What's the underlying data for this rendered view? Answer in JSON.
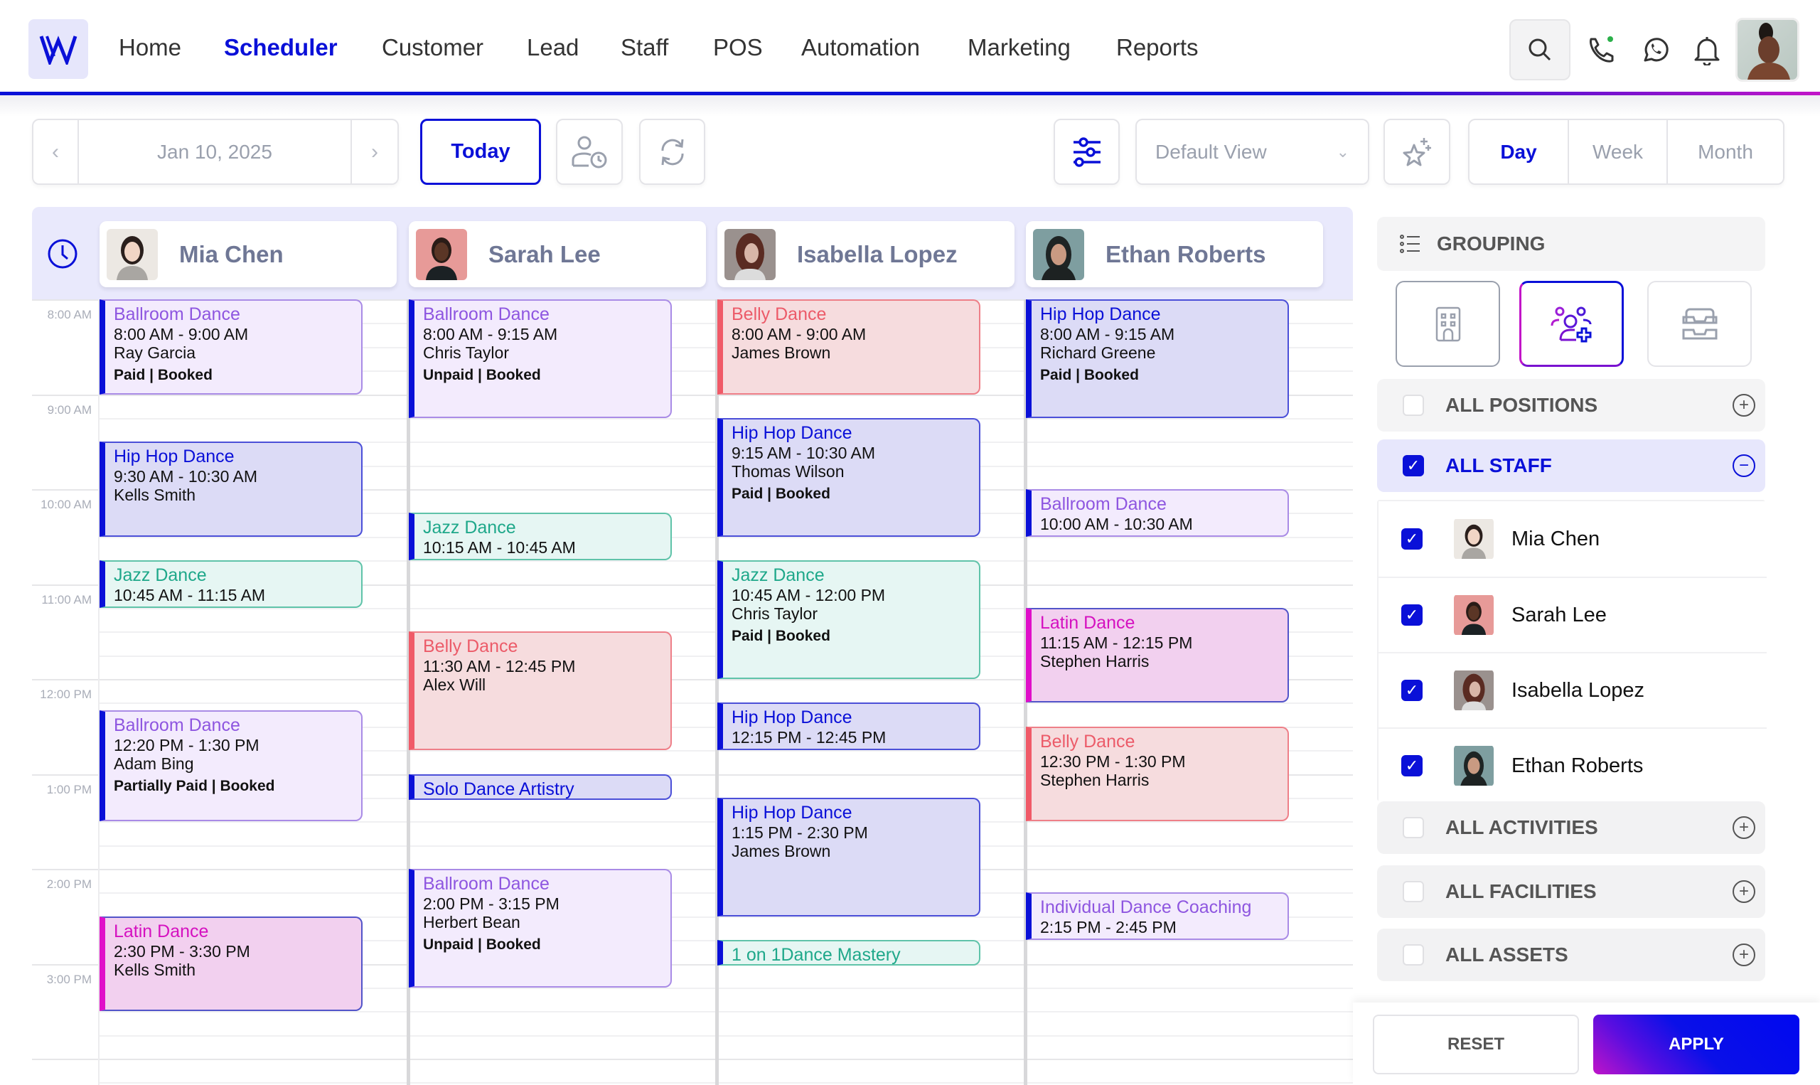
{
  "header": {
    "logo_letter": "W",
    "nav": [
      {
        "label": "Home",
        "active": false
      },
      {
        "label": "Scheduler",
        "active": true
      },
      {
        "label": "Customer",
        "active": false
      },
      {
        "label": "Lead",
        "active": false
      },
      {
        "label": "Staff",
        "active": false
      },
      {
        "label": "POS",
        "active": false
      },
      {
        "label": "Automation",
        "active": false
      },
      {
        "label": "Marketing",
        "active": false
      },
      {
        "label": "Reports",
        "active": false
      }
    ],
    "icons": [
      "search-icon",
      "phone-icon",
      "whatsapp-icon",
      "bell-icon"
    ],
    "phone_status_color": "#2bb04a"
  },
  "toolbar": {
    "date": "Jan 10, 2025",
    "today_label": "Today",
    "view_select": "Default View",
    "view_modes": [
      {
        "label": "Day",
        "active": true
      },
      {
        "label": "Week",
        "active": false
      },
      {
        "label": "Month",
        "active": false
      }
    ]
  },
  "colors": {
    "accent": "#0a10d8",
    "magenta": "#d511c0"
  },
  "calendar": {
    "staff": [
      {
        "name": "Mia Chen",
        "photo_bg": "#e9e6e2"
      },
      {
        "name": "Sarah Lee",
        "photo_bg": "#e79a98"
      },
      {
        "name": "Isabella Lopez",
        "photo_bg": "#9a8f8c"
      },
      {
        "name": "Ethan Roberts",
        "photo_bg": "#6f8f92"
      }
    ],
    "time_labels": [
      "8:00 AM",
      "9:00 AM",
      "10:00 AM",
      "11:00 AM",
      "12:00 PM",
      "1:00 PM",
      "2:00 PM",
      "3:00 PM"
    ],
    "events": [
      {
        "col": 0,
        "type": "ballroom",
        "title": "Ballroom Dance",
        "time": "8:00 AM - 9:00 AM",
        "start": 8.0,
        "end": 9.0,
        "client": "Ray Garcia",
        "status": "Paid | Booked"
      },
      {
        "col": 0,
        "type": "hiphop",
        "title": "Hip Hop Dance",
        "time": "9:30 AM - 10:30 AM",
        "start": 9.5,
        "end": 10.5,
        "client": "Kells Smith",
        "status": ""
      },
      {
        "col": 0,
        "type": "jazz",
        "title": "Jazz Dance",
        "time": "10:45 AM - 11:15 AM",
        "start": 10.75,
        "end": 11.25,
        "client": "",
        "status": ""
      },
      {
        "col": 0,
        "type": "ballroom",
        "title": "Ballroom Dance",
        "time": "12:20 PM - 1:30 PM",
        "start": 12.33,
        "end": 13.5,
        "client": "Adam Bing",
        "status": "Partially Paid | Booked"
      },
      {
        "col": 0,
        "type": "latin",
        "title": "Latin Dance",
        "time": "2:30 PM - 3:30 PM",
        "start": 14.5,
        "end": 15.5,
        "client": "Kells Smith",
        "status": ""
      },
      {
        "col": 1,
        "type": "ballroom",
        "title": "Ballroom Dance",
        "time": "8:00 AM - 9:15 AM",
        "start": 8.0,
        "end": 9.25,
        "client": "Chris Taylor",
        "status": "Unpaid | Booked"
      },
      {
        "col": 1,
        "type": "jazz",
        "title": "Jazz Dance",
        "time": "10:15 AM - 10:45 AM",
        "start": 10.25,
        "end": 10.75,
        "client": "",
        "status": ""
      },
      {
        "col": 1,
        "type": "belly",
        "title": "Belly Dance",
        "time": "11:30 AM - 12:45 PM",
        "start": 11.5,
        "end": 12.75,
        "client": "Alex Will",
        "status": ""
      },
      {
        "col": 1,
        "type": "hiphop",
        "title": "Solo Dance Artistry",
        "time": "",
        "start": 13.0,
        "end": 13.25,
        "client": "",
        "status": ""
      },
      {
        "col": 1,
        "type": "ballroom",
        "title": "Ballroom Dance",
        "time": "2:00 PM - 3:15 PM",
        "start": 14.0,
        "end": 15.25,
        "client": "Herbert Bean",
        "status": "Unpaid | Booked"
      },
      {
        "col": 2,
        "type": "belly",
        "title": "Belly Dance",
        "time": "8:00 AM - 9:00 AM",
        "start": 8.0,
        "end": 9.0,
        "client": "James Brown",
        "status": ""
      },
      {
        "col": 2,
        "type": "hiphop",
        "title": "Hip Hop Dance",
        "time": "9:15 AM - 10:30 AM",
        "start": 9.25,
        "end": 10.5,
        "client": "Thomas Wilson",
        "status": "Paid | Booked"
      },
      {
        "col": 2,
        "type": "jazz",
        "title": "Jazz Dance",
        "time": "10:45 AM - 12:00 PM",
        "start": 10.75,
        "end": 12.0,
        "client": "Chris Taylor",
        "status": "Paid | Booked"
      },
      {
        "col": 2,
        "type": "hiphop",
        "title": "Hip Hop Dance",
        "time": "12:15 PM - 12:45 PM",
        "start": 12.25,
        "end": 12.75,
        "client": "",
        "status": ""
      },
      {
        "col": 2,
        "type": "hiphop",
        "title": "Hip Hop Dance",
        "time": "1:15 PM - 2:30 PM",
        "start": 13.25,
        "end": 14.5,
        "client": "James Brown",
        "status": ""
      },
      {
        "col": 2,
        "type": "jazz",
        "title": "1 on 1Dance Mastery",
        "time": "",
        "start": 14.75,
        "end": 15.0,
        "client": "",
        "status": ""
      },
      {
        "col": 3,
        "type": "hiphop",
        "title": "Hip Hop Dance",
        "time": "8:00 AM - 9:15 AM",
        "start": 8.0,
        "end": 9.25,
        "client": "Richard Greene",
        "status": "Paid | Booked"
      },
      {
        "col": 3,
        "type": "ballroom",
        "title": "Ballroom Dance",
        "time": "10:00 AM - 10:30 AM",
        "start": 10.0,
        "end": 10.5,
        "client": "",
        "status": ""
      },
      {
        "col": 3,
        "type": "latin",
        "title": "Latin Dance",
        "time": "11:15 AM - 12:15 PM",
        "start": 11.25,
        "end": 12.25,
        "client": "Stephen Harris",
        "status": ""
      },
      {
        "col": 3,
        "type": "belly",
        "title": "Belly Dance",
        "time": "12:30 PM - 1:30 PM",
        "start": 12.5,
        "end": 13.5,
        "client": "Stephen Harris",
        "status": ""
      },
      {
        "col": 3,
        "type": "ballroom",
        "title": "Individual Dance Coaching",
        "time": "2:15 PM - 2:45 PM",
        "start": 14.25,
        "end": 14.75,
        "client": "",
        "status": ""
      }
    ]
  },
  "panel": {
    "grouping_label": "GROUPING",
    "grouping_options": [
      {
        "icon": "building-icon",
        "active": false
      },
      {
        "icon": "staff-group-icon",
        "active": true
      },
      {
        "icon": "inbox-tray-icon",
        "active": false
      }
    ],
    "all_positions": {
      "label": "ALL POSITIONS",
      "checked": false
    },
    "all_staff": {
      "label": "ALL STAFF",
      "checked": true
    },
    "staff": [
      {
        "name": "Mia Chen",
        "checked": true
      },
      {
        "name": "Sarah Lee",
        "checked": true
      },
      {
        "name": "Isabella Lopez",
        "checked": true
      },
      {
        "name": "Ethan Roberts",
        "checked": true
      }
    ],
    "all_activities": {
      "label": "ALL ACTIVITIES",
      "checked": false
    },
    "all_facilities": {
      "label": "ALL FACILITIES",
      "checked": false
    },
    "all_assets": {
      "label": "ALL ASSETS",
      "checked": false
    },
    "reset_label": "RESET",
    "apply_label": "APPLY"
  }
}
